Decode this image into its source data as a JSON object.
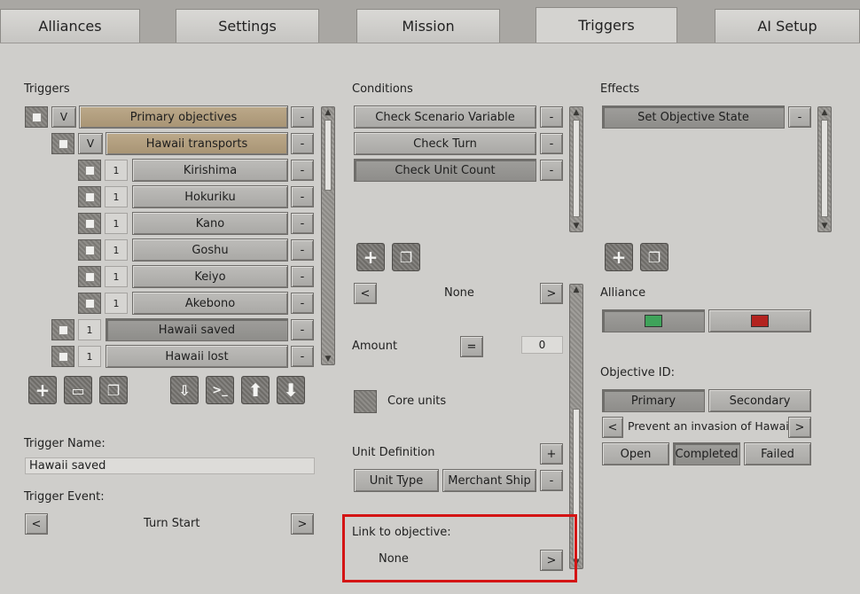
{
  "tabs": [
    "Alliances",
    "Settings",
    "Mission",
    "Triggers",
    "AI Setup"
  ],
  "triggers": {
    "header": "Triggers",
    "rows": [
      {
        "toggle": "V",
        "label": "Primary objectives"
      },
      {
        "toggle": "V",
        "label": "Hawaii transports"
      },
      {
        "toggle": "1",
        "label": "Kirishima"
      },
      {
        "toggle": "1",
        "label": "Hokuriku"
      },
      {
        "toggle": "1",
        "label": "Kano"
      },
      {
        "toggle": "1",
        "label": "Goshu"
      },
      {
        "toggle": "1",
        "label": "Keiyo"
      },
      {
        "toggle": "1",
        "label": "Akebono"
      },
      {
        "toggle": "1",
        "label": "Hawaii saved"
      },
      {
        "toggle": "1",
        "label": "Hawaii  lost"
      }
    ],
    "minus": "-",
    "trigger_name_label": "Trigger Name:",
    "trigger_name_value": "Hawaii saved",
    "trigger_event_label": "Trigger Event:",
    "trigger_event_value": "Turn Start",
    "prev": "<",
    "next": ">"
  },
  "conditions": {
    "header": "Conditions",
    "items": [
      "Check Scenario Variable",
      "Check Turn",
      "Check Unit Count"
    ],
    "minus": "-",
    "selector_value": "None",
    "prev": "<",
    "next": ">",
    "amount_label": "Amount",
    "amount_op": "=",
    "amount_value": "0",
    "core_units_label": "Core units",
    "unit_definition_label": "Unit Definition",
    "plus": "+",
    "unit_type_label": "Unit Type",
    "unit_type_value": "Merchant Ship",
    "link_label": "Link to objective:",
    "link_value": "None"
  },
  "effects": {
    "header": "Effects",
    "items": [
      "Set Objective State"
    ],
    "minus": "-",
    "alliance_label": "Alliance",
    "alliance_colors": [
      "#3fa35a",
      "#b3231f"
    ],
    "objective_id_label": "Objective ID:",
    "objective_types": [
      "Primary",
      "Secondary"
    ],
    "objective_value": "Prevent an invasion of Hawaii",
    "prev": "<",
    "next": ">",
    "states": [
      "Open",
      "Completed",
      "Failed"
    ]
  }
}
